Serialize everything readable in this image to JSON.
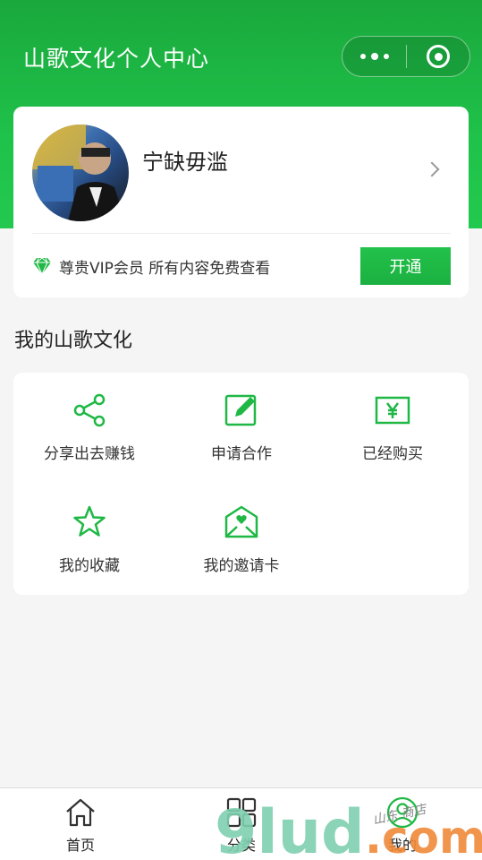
{
  "nav": {
    "title": "山歌文化个人中心"
  },
  "profile": {
    "username": "宁缺毋滥",
    "vip_text": "尊贵VIP会员 所有内容免费查看",
    "open_button": "开通"
  },
  "section": {
    "title": "我的山歌文化"
  },
  "grid": [
    {
      "label": "分享出去赚钱",
      "icon": "share-icon"
    },
    {
      "label": "申请合作",
      "icon": "edit-icon"
    },
    {
      "label": "已经购买",
      "icon": "yen-ticket-icon"
    },
    {
      "label": "我的收藏",
      "icon": "star-icon"
    },
    {
      "label": "我的邀请卡",
      "icon": "invite-card-icon"
    }
  ],
  "tabbar": [
    {
      "label": "首页",
      "icon": "home-icon"
    },
    {
      "label": "分类",
      "icon": "grid-icon"
    },
    {
      "label": "我的",
      "icon": "user-icon"
    }
  ],
  "watermark": {
    "text": "9lud.com",
    "script_text": "山东 商店"
  },
  "colors": {
    "primary_green": "#1fb845",
    "header_green": "#1aa83c",
    "background": "#f5f5f5"
  }
}
